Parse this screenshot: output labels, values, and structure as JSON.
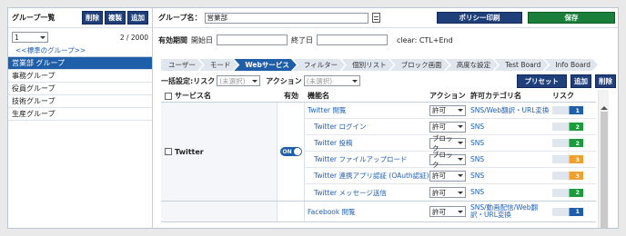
{
  "left": {
    "title": "グループ一覧",
    "buttons": [
      "削除",
      "複製",
      "追加"
    ],
    "page_select": "1",
    "page_count": "2 / 2000",
    "prev_link": "<<標準のグループ>>",
    "groups": [
      "営業部 グループ",
      "事務グループ",
      "役員グループ",
      "技術グループ",
      "生産グループ"
    ]
  },
  "header": {
    "group_label": "グループ名：",
    "group_value": "営業部",
    "policy_print": "ポリシー印刷",
    "save": "保存"
  },
  "period": {
    "label": "有効期間",
    "start": "開始日",
    "end": "終了日",
    "clear_hint": "clear: CTL+End"
  },
  "tabs": [
    "ユーザー",
    "モード",
    "Webサービス",
    "フィルター",
    "個別リスト",
    "ブロック画面",
    "高度な設定",
    "Test Board",
    "Info Board"
  ],
  "bulk": {
    "label": "一括設定:リスク",
    "risk_placeholder": "(未選択)",
    "action_label": "アクション",
    "action_placeholder": "(未選択)",
    "preset": "プリセット",
    "add": "追加",
    "delete": "削除"
  },
  "table": {
    "headers": [
      "サービス名",
      "有効",
      "機能名",
      "アクション",
      "許可カテゴリ名",
      "リスク"
    ],
    "services": [
      {
        "name": "Twitter",
        "toggle": "ON",
        "rows": [
          {
            "fn": "Twitter 閲覧",
            "action": "許可",
            "category": "SNS/Web翻訳・URL変換",
            "risk": "1"
          },
          {
            "fn": "Twitter ログイン",
            "action": "許可",
            "category": "SNS",
            "risk": "2"
          },
          {
            "fn": "Twitter 投稿",
            "action": "ブロック",
            "category": "SNS",
            "risk": "2"
          },
          {
            "fn": "Twitter ファイルアップロード",
            "action": "ブロック",
            "category": "SNS",
            "risk": "3"
          },
          {
            "fn": "Twitter 連携アプリ認証 (OAuth認証)",
            "action": "許可",
            "category": "SNS",
            "risk": "3"
          },
          {
            "fn": "Twitter メッセージ送信",
            "action": "許可",
            "category": "SNS",
            "risk": "2"
          }
        ]
      },
      {
        "name": "",
        "toggle": "",
        "rows": [
          {
            "fn": "Facebook 閲覧",
            "action": "許可",
            "category": "SNS/動画配信/Web翻訳・URL変換",
            "risk": "1"
          }
        ]
      }
    ]
  },
  "colors": {
    "navy": "#1f3f7a",
    "blue": "#1f5faa",
    "green": "#1a7f3a",
    "orange": "#f0a030"
  }
}
